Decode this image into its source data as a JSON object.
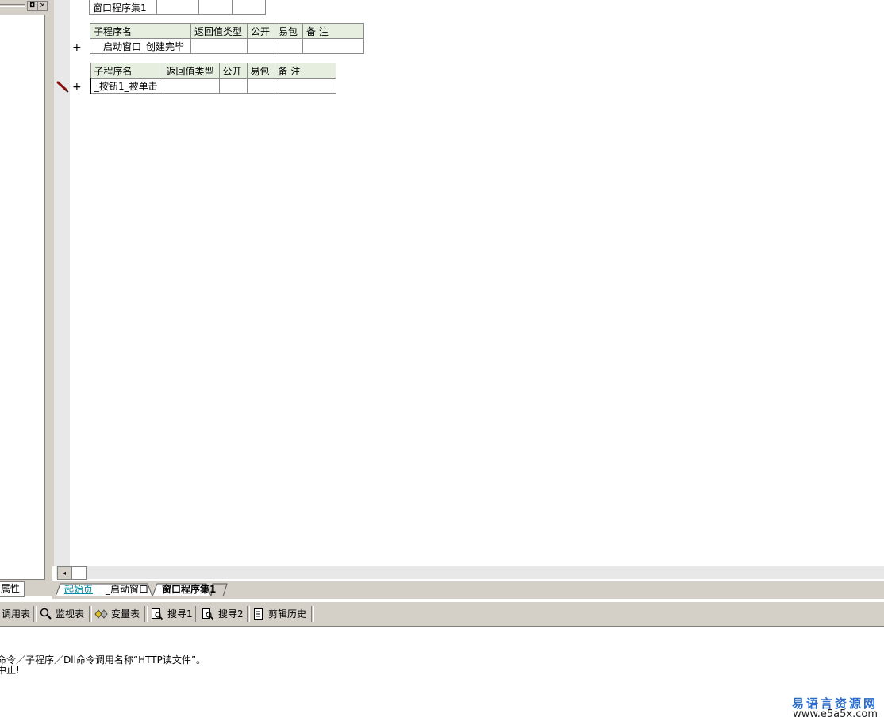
{
  "left_panel": {
    "restore_glyph": "◘",
    "close_glyph": "×",
    "tab_label": "属性"
  },
  "editor": {
    "class_table": {
      "name": "窗口程序集1"
    },
    "sub_tables": [
      {
        "headers": [
          "子程序名",
          "返回值类型",
          "公开",
          "易包",
          "备 注"
        ],
        "row": [
          "__启动窗口_创建完毕",
          "",
          "",
          "",
          ""
        ]
      },
      {
        "headers": [
          "子程序名",
          "返回值类型",
          "公开",
          "易包",
          "备 注"
        ],
        "row": [
          "_按钮1_被单击",
          "",
          "",
          "",
          ""
        ]
      }
    ],
    "expand_glyph": "+",
    "scroll_left_glyph": "◂"
  },
  "tabs": [
    "起始页",
    "_启动窗口",
    "窗口程序集1"
  ],
  "toolbar": [
    {
      "label": "调用表",
      "icon": ""
    },
    {
      "label": "监视表",
      "icon": "magnifier-icon"
    },
    {
      "label": "变量表",
      "icon": "variables-icon"
    },
    {
      "label": "搜寻1",
      "icon": "search-doc-icon"
    },
    {
      "label": "搜寻2",
      "icon": "search-doc-icon"
    },
    {
      "label": "剪辑历史",
      "icon": "clipboard-icon"
    }
  ],
  "output": {
    "lines": [
      "命令／子程序／Dll命令调用名称“HTTP读文件”。",
      "中止!"
    ]
  },
  "watermark": {
    "chinese": "易语言资源网",
    "url": "www.e5a5x.com"
  },
  "colors": {
    "tab_active_cyan": "#0a8ca0",
    "table_header_bg": "#e6eee0",
    "logo_blue": "#2a6bc9"
  }
}
